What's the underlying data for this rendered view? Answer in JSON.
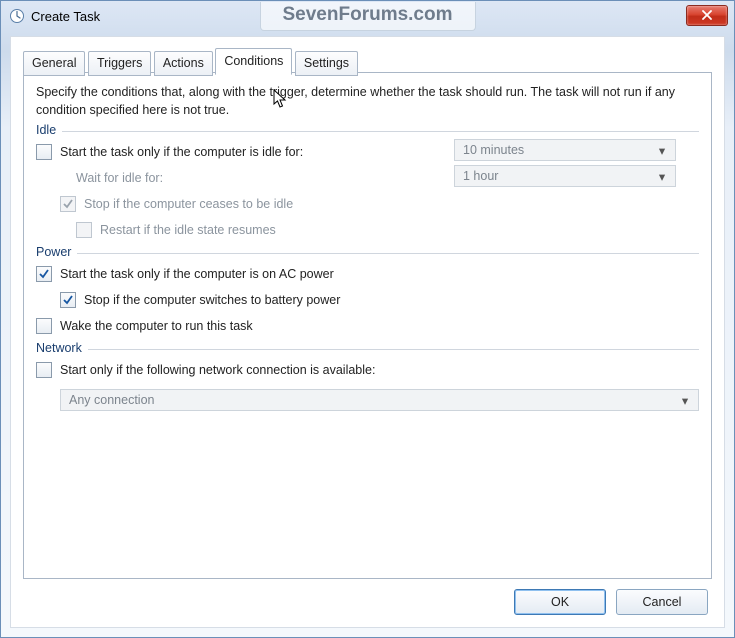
{
  "window": {
    "title": "Create Task",
    "watermark": "SevenForums.com",
    "ok": "OK",
    "cancel": "Cancel"
  },
  "tabs": {
    "general": "General",
    "triggers": "Triggers",
    "actions": "Actions",
    "conditions": "Conditions",
    "settings": "Settings"
  },
  "panel": {
    "description": "Specify the conditions that, along with the trigger, determine whether the task should run.  The task will not run  if any condition specified here is not true.",
    "idle": {
      "header": "Idle",
      "start_only_idle": "Start the task only if the computer is idle for:",
      "wait_for_idle": "Wait for idle for:",
      "idle_duration": "10 minutes",
      "wait_duration": "1 hour",
      "stop_cease_idle": "Stop if the computer ceases to be idle",
      "restart_idle": "Restart if the idle state resumes"
    },
    "power": {
      "header": "Power",
      "ac_power": "Start the task only if the computer is on AC power",
      "stop_battery": "Stop if the computer switches to battery power",
      "wake": "Wake the computer to run this task"
    },
    "network": {
      "header": "Network",
      "start_only_net": "Start only if the following network connection is available:",
      "any_connection": "Any connection"
    }
  }
}
